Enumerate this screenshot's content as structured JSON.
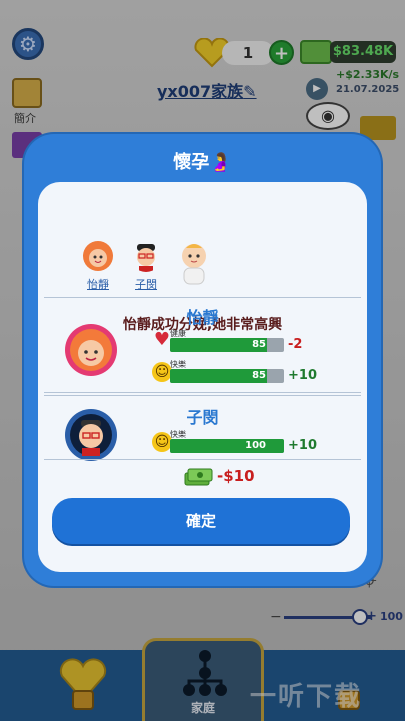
{
  "hud": {
    "hearts": "1",
    "plus": "+",
    "money": "$83.48K",
    "rate": "+$2.33K/s",
    "date": "21.07.2025",
    "family_name": "yx007家族",
    "edit_icon": "pencil-icon"
  },
  "sidebar": {
    "intro_label": "簡介"
  },
  "zoom": {
    "minus": "−",
    "plus": "+",
    "value": "100"
  },
  "modal": {
    "title": "懷孕",
    "participants": [
      {
        "name": "怡靜"
      },
      {
        "name": "子閔"
      }
    ],
    "message": "怡靜成功分娩,她非常高興",
    "mother": {
      "name": "怡靜",
      "health_label": "健康",
      "health_value": "85",
      "health_fraction": 0.85,
      "health_delta": "-2",
      "happy_label": "快樂",
      "happy_value": "85",
      "happy_fraction": 0.85,
      "happy_delta": "+10"
    },
    "father": {
      "name": "子閔",
      "happy_label": "快樂",
      "happy_value": "100",
      "happy_fraction": 1.0,
      "happy_delta": "+10"
    },
    "cost": "-$10",
    "confirm": "確定"
  },
  "bottom_nav": {
    "family_label": "家庭"
  },
  "watermark": "一听下载",
  "colors": {
    "modal_blue": "#2f7ed8",
    "bar_green": "#1f9a3a",
    "negative_red": "#c81e1e",
    "positive_green": "#1f7a2e"
  }
}
